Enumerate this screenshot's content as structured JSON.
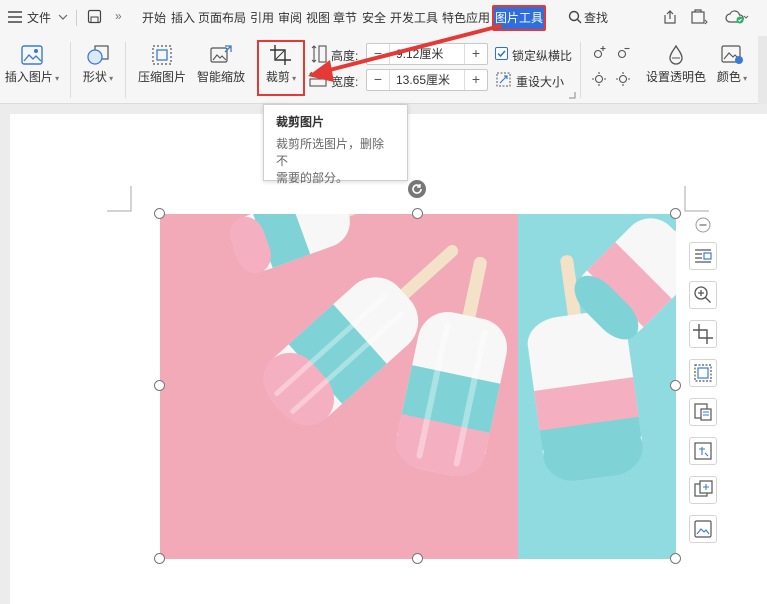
{
  "menu": {
    "hamburger_icon": "menu-icon",
    "file_label": "文件",
    "items": [
      "开始",
      "插入",
      "页面布局",
      "引用",
      "审阅",
      "视图",
      "章节",
      "安全",
      "开发工具",
      "特色应用"
    ],
    "active_tab": "图片工具",
    "find_label": "查找"
  },
  "ribbon": {
    "insert_image": "插入图片",
    "shape": "形状",
    "compress": "压缩图片",
    "smart_zoom": "智能缩放",
    "crop": "裁剪",
    "height_label": "高度:",
    "height_value": "9.12厘米",
    "width_label": "宽度:",
    "width_value": "13.65厘米",
    "lock_ratio": "锁定纵横比",
    "reset_size": "重设大小",
    "set_transparent": "设置透明色",
    "color": "颜色"
  },
  "tooltip": {
    "title": "裁剪图片",
    "body_line1": "裁剪所选图片，删除不",
    "body_line2": "需要的部分。"
  },
  "colors": {
    "accent": "#2f6fdd",
    "highlight_red": "#e53935",
    "pink": "#f2aab8",
    "cyan": "#8fdbe0"
  }
}
